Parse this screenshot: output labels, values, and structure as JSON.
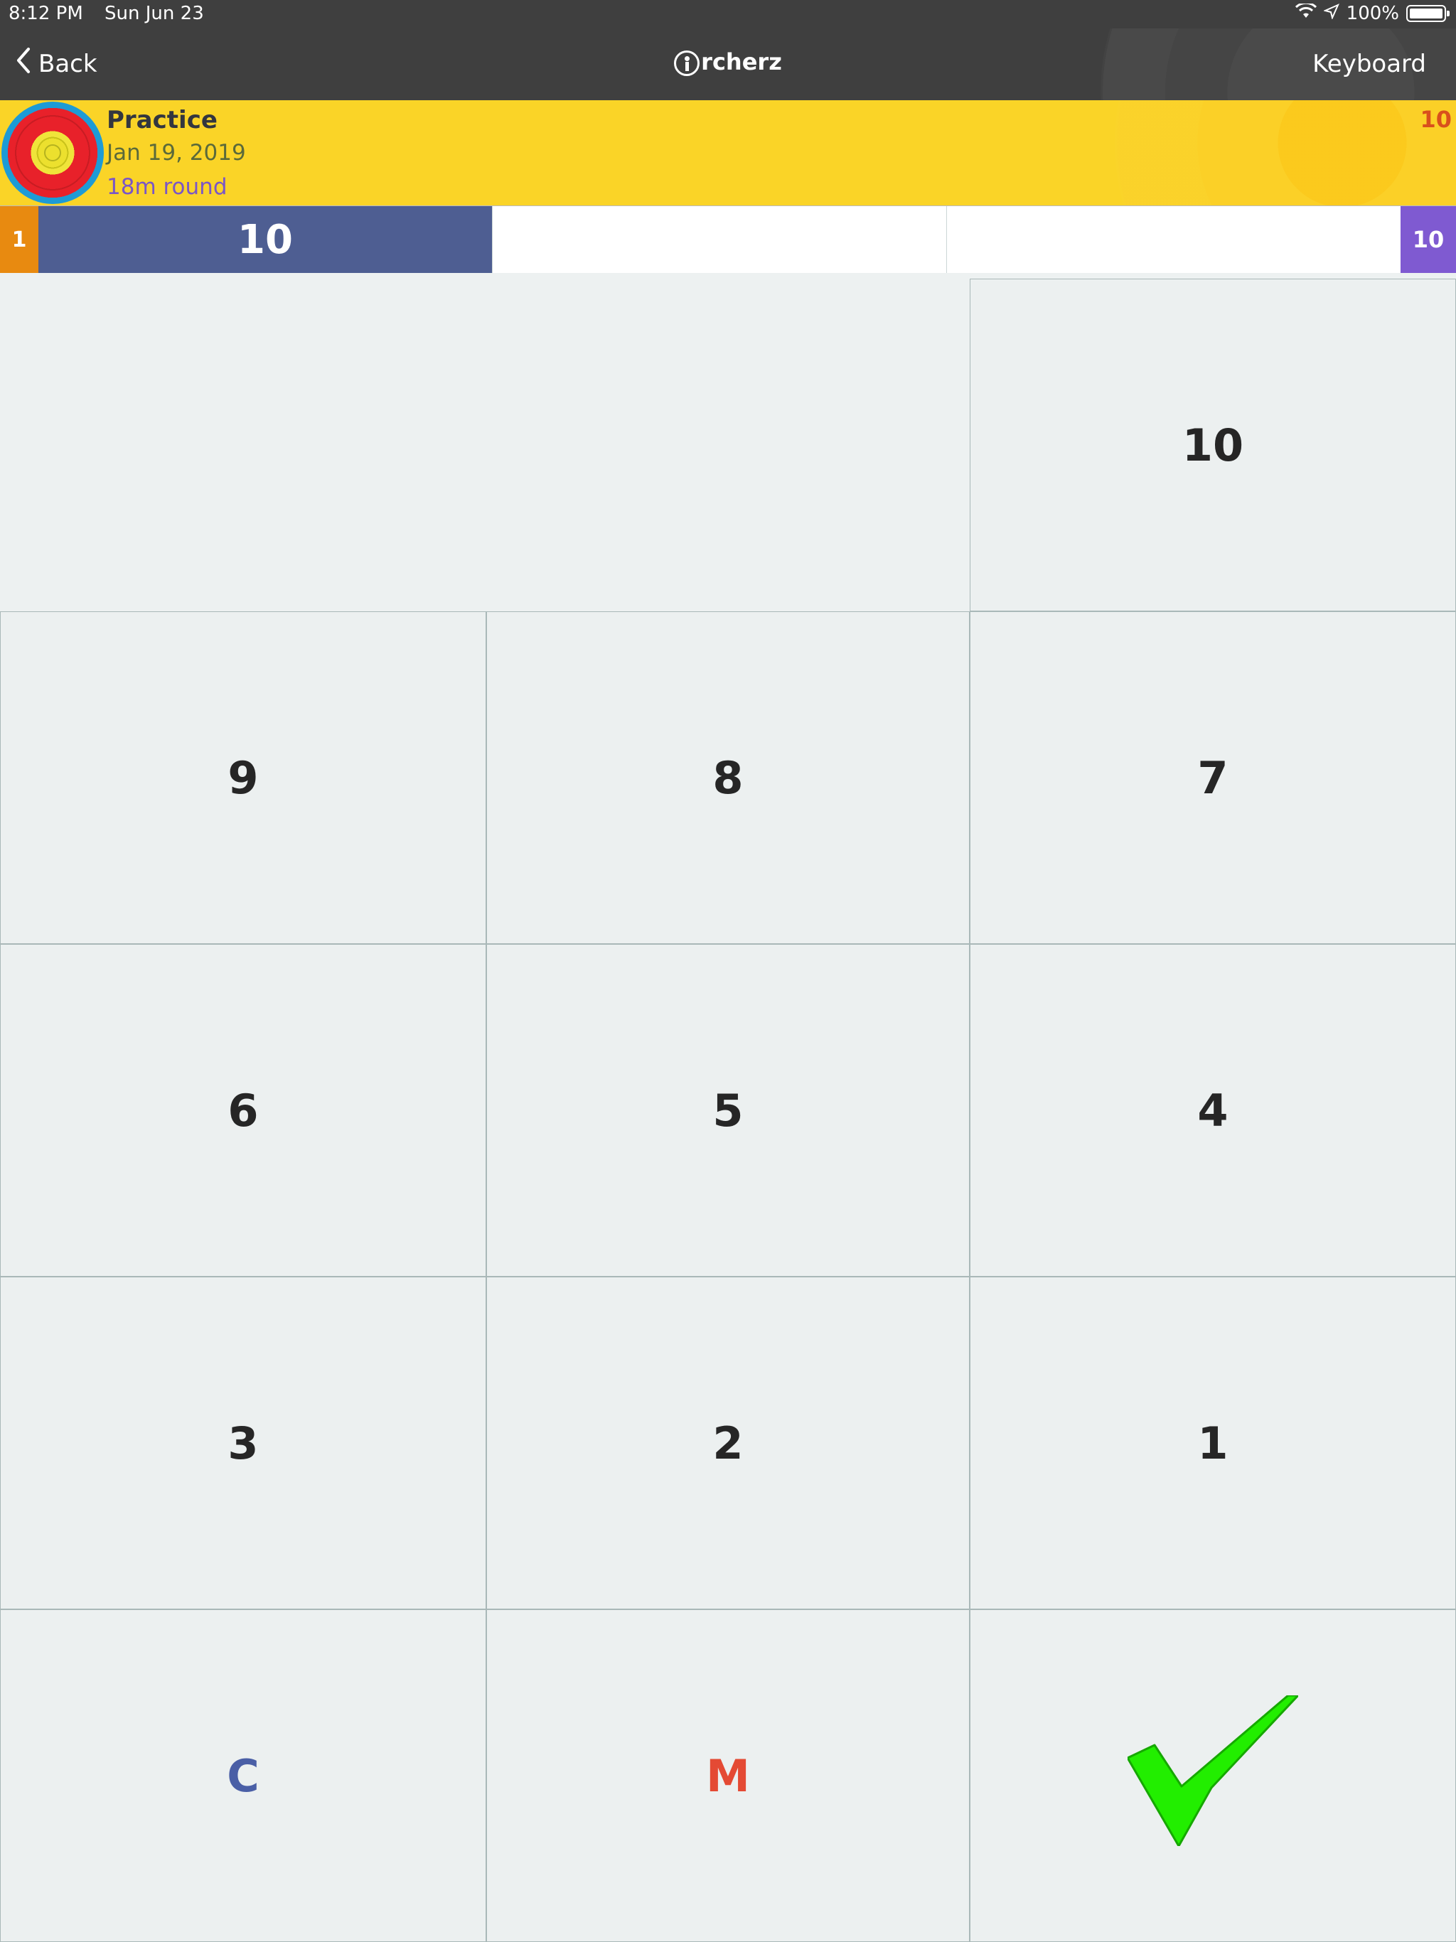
{
  "status_bar": {
    "time": "8:12 PM",
    "date": "Sun Jun 23",
    "battery": "100%"
  },
  "nav": {
    "back_label": "Back",
    "logo_text": "rcherz",
    "keyboard_label": "Keyboard"
  },
  "session": {
    "title": "Practice",
    "date": "Jan 19, 2019",
    "round": "18m round",
    "total": "10"
  },
  "end": {
    "number": "1",
    "arrows": [
      "10",
      "",
      ""
    ],
    "total": "10"
  },
  "keypad": {
    "k10": "10",
    "k9": "9",
    "k8": "8",
    "k7": "7",
    "k6": "6",
    "k5": "5",
    "k4": "4",
    "k3": "3",
    "k2": "2",
    "k1": "1",
    "clear": "C",
    "miss": "M",
    "confirm_icon": "checkmark-icon"
  },
  "colors": {
    "nav_bg": "#3f3f3f",
    "header_bg": "#fad427",
    "arrow_active": "#4e5e92",
    "end_number_bg": "#e88a10",
    "end_total_bg": "#7f5ad1",
    "check_green": "#22ee00"
  }
}
